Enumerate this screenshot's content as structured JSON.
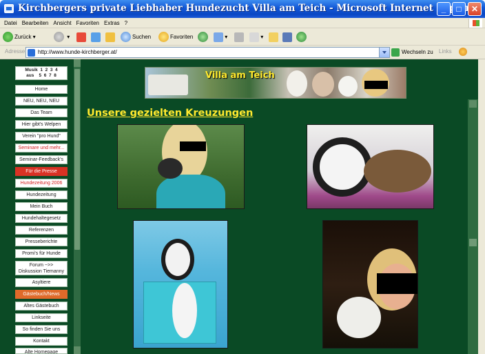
{
  "window": {
    "title": "Kirchbergers private Liebhaber Hundezucht Villa am Teich - Microsoft Internet Explorer",
    "min_glyph": "_",
    "max_glyph": "□",
    "close_glyph": "✕"
  },
  "menu": [
    "Datei",
    "Bearbeiten",
    "Ansicht",
    "Favoriten",
    "Extras",
    "?"
  ],
  "toolbar": {
    "back": "Zurück",
    "search": "Suchen",
    "favorites": "Favoriten"
  },
  "address": {
    "label": "Adresse",
    "url": "http://www.hunde-kirchberger.at/",
    "go": "Wechseln zu",
    "links": "Links"
  },
  "nav": {
    "music": "Musik  1  2  3  4\naus    5  6  7  8",
    "items": [
      "Home",
      "NEU, NEU, NEU",
      "Das Team",
      "Hier gibt's Welpen",
      "Verein \"pro Hund\"",
      "Seminare und mehr...",
      "Seminar-Feedback's",
      "Für die Presse",
      "Hundezeitung 2006",
      "Hundezeitung",
      "Mein Buch",
      "Hundehaltegesetz",
      "Referenzen",
      "Presseberichte",
      "Promi's für Hunde",
      "Forum ~>>\nDiskussion Tiemanny",
      "Asyltiere",
      "Gästebuch/News",
      "Altes Gästebuch",
      "Linkseite",
      "So finden Sie uns",
      "Kontakt",
      "Alte Homepage"
    ]
  },
  "main": {
    "banner_title": "Villa am Teich",
    "heading": "Unsere gezielten Kreuzungen"
  },
  "colors": {
    "page_bg": "#0a4a25",
    "heading": "#ffe92e",
    "nav_red": "#d83224",
    "nav_orange": "#e06a2a"
  }
}
